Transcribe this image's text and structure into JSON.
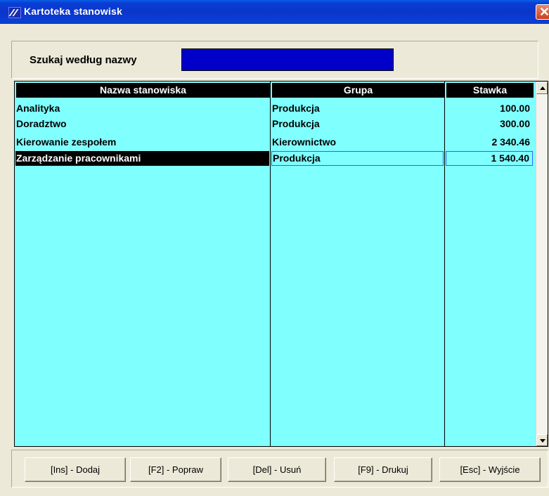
{
  "window": {
    "title": "Kartoteka stanowisk",
    "close_icon": "close-icon"
  },
  "search": {
    "label": "Szukaj według nazwy",
    "value": ""
  },
  "table": {
    "columns": [
      "Nazwa stanowiska",
      "Grupa",
      "Stawka"
    ],
    "rows": [
      {
        "name": "Analityka",
        "group": "Produkcja",
        "rate": "100.00"
      },
      {
        "name": "Doradztwo",
        "group": "Produkcja",
        "rate": "300.00"
      },
      {
        "name": "Kierowanie zespołem",
        "group": "Kierownictwo",
        "rate": "2 340.46"
      },
      {
        "name": "Zarządzanie pracownikami",
        "group": "Produkcja",
        "rate": "1 540.40"
      }
    ],
    "selected_row": 3
  },
  "buttons": {
    "add": "[Ins] - Dodaj",
    "edit": "[F2] - Popraw",
    "delete": "[Del] - Usuń",
    "print": "[F9] - Drukuj",
    "exit": "[Esc] - Wyjście"
  },
  "colors": {
    "grid_bg": "#80ffff",
    "header_bg": "#000000",
    "search_bg": "#0000c8",
    "titlebar": "#0a3ed6"
  }
}
